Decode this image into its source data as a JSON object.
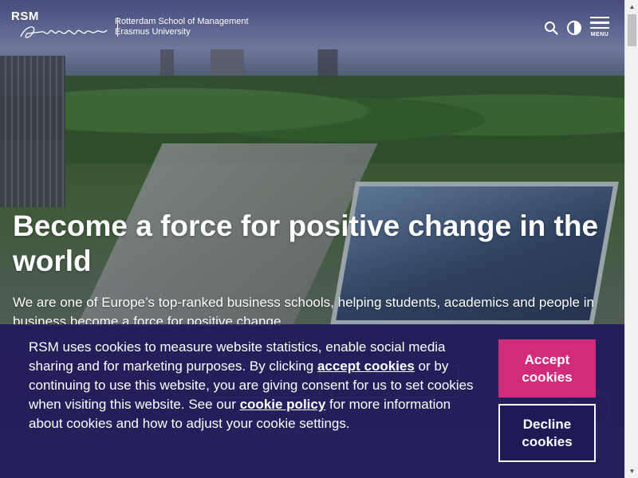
{
  "header": {
    "logo_abbr": "RSM",
    "logo_line1": "Rotterdam School of Management",
    "logo_line2": "Erasmus University",
    "menu_label": "MENU",
    "icons": [
      "search-icon",
      "contrast-icon",
      "hamburger-menu-icon"
    ]
  },
  "hero": {
    "title": "Become a force for positive change in the world",
    "subtitle": "We are one of Europe’s top-ranked business schools, helping students, academics and people in business become a force for positive change."
  },
  "cookie": {
    "text_before_link1": "RSM uses cookies to measure website statistics, enable social media sharing and for marketing purposes. By clicking ",
    "link1": "accept cookies",
    "text_middle": " or by continuing to use this website, you are giving consent for us to set cookies when visiting this website. See our ",
    "link2": "cookie policy",
    "text_after_link2": " for more information about cookies and how to adjust your cookie settings.",
    "accept_label": "Accept cookies",
    "decline_label": "Decline cookies"
  },
  "colors": {
    "brand_navy": "#1e1a5a",
    "brand_magenta": "#d32b7c"
  }
}
